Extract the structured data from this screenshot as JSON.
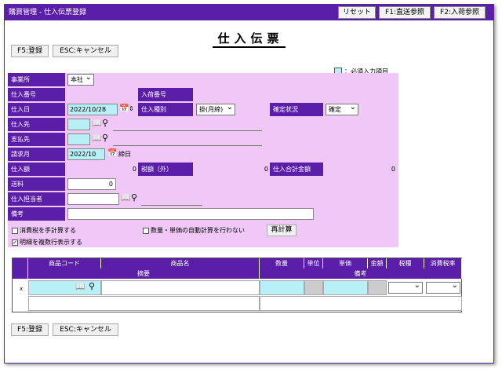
{
  "title": "購買管理 - 仕入伝票登録",
  "topbuttons": {
    "reset": "リセット",
    "direct": "F1:直送参照",
    "receipt": "F2:入荷参照"
  },
  "page_title": "仕入伝票",
  "actions": {
    "save": "F5:登録",
    "cancel": "ESC:キャンセル"
  },
  "legend": "：必須入力項目",
  "form": {
    "office_label": "事業所",
    "office_value": "本社",
    "purchase_no_label": "仕入番号",
    "receipt_no_label": "入荷番号",
    "date_label": "仕入日",
    "date_value": "2022/10/28",
    "type_label": "仕入種別",
    "type_value": "掛(月締)",
    "status_label": "確定状況",
    "status_value": "確定",
    "supplier_label": "仕入先",
    "payee_label": "支払先",
    "billing_label": "請求月",
    "billing_value": "2022/10",
    "closing_label": "締日",
    "amount_label": "仕入額",
    "amount_value": "0",
    "tax_label": "税額（外）",
    "tax_value": "0",
    "total_label": "仕入合計金額",
    "total_value": "0",
    "shipping_label": "送料",
    "shipping_value": "0",
    "staff_label": "仕入担当者",
    "note_label": "備考",
    "manual_tax": "消費税を手計算する",
    "no_auto_calc": "数量・単価の自動計算を行わない",
    "recalc": "再計算",
    "multi_line": "明細を複数行表示する"
  },
  "grid": {
    "code": "商品コード",
    "name": "商品名",
    "summary": "摘要",
    "qty": "数量",
    "unit": "単位",
    "price": "単価",
    "amount": "金額",
    "tax_type": "税種",
    "tax_rate": "消費税率",
    "note": "備考",
    "row_marker": "x"
  }
}
